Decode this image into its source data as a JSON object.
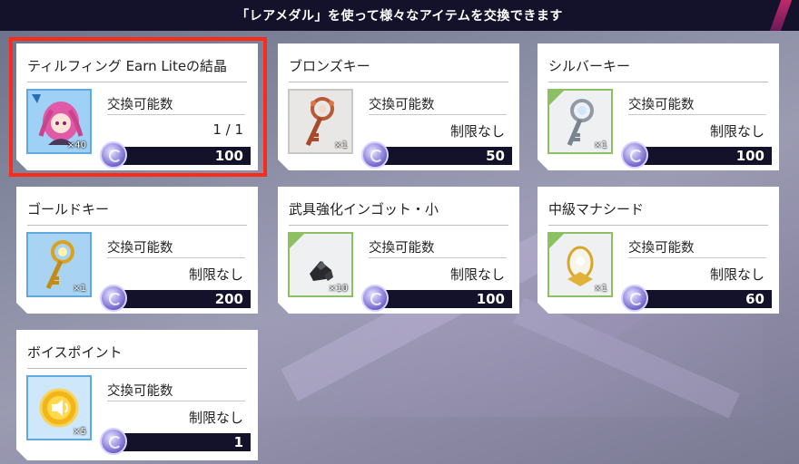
{
  "header": {
    "text": "「レアメダル」を使って様々なアイテムを交換できます"
  },
  "common": {
    "exchange_label": "交換可能数"
  },
  "items": [
    {
      "name": "ティルフィング Earn Liteの結晶",
      "remaining": "1 / 1",
      "qty": "×40",
      "price": "100",
      "icon": "character-portrait-icon",
      "thumb_style": "blue"
    },
    {
      "name": "ブロンズキー",
      "remaining": "制限なし",
      "qty": "×1",
      "price": "50",
      "icon": "bronze-key-icon",
      "thumb_style": "plain"
    },
    {
      "name": "シルバーキー",
      "remaining": "制限なし",
      "qty": "×1",
      "price": "100",
      "icon": "silver-key-icon",
      "thumb_style": "green"
    },
    {
      "name": "ゴールドキー",
      "remaining": "制限なし",
      "qty": "×1",
      "price": "200",
      "icon": "gold-key-icon",
      "thumb_style": "blue"
    },
    {
      "name": "武具強化インゴット・小",
      "remaining": "制限なし",
      "qty": "×10",
      "price": "100",
      "icon": "ingot-icon",
      "thumb_style": "green"
    },
    {
      "name": "中級マナシード",
      "remaining": "制限なし",
      "qty": "×1",
      "price": "60",
      "icon": "mana-seed-icon",
      "thumb_style": "green"
    },
    {
      "name": "ボイスポイント",
      "remaining": "制限なし",
      "qty": "×5",
      "price": "1",
      "icon": "voice-point-icon",
      "thumb_style": "blue"
    }
  ],
  "currency_icon": "rare-medal-icon",
  "colors": {
    "header_bg": "#14122a",
    "highlight": "#ff2a1a",
    "price_bar": "#14122a"
  }
}
